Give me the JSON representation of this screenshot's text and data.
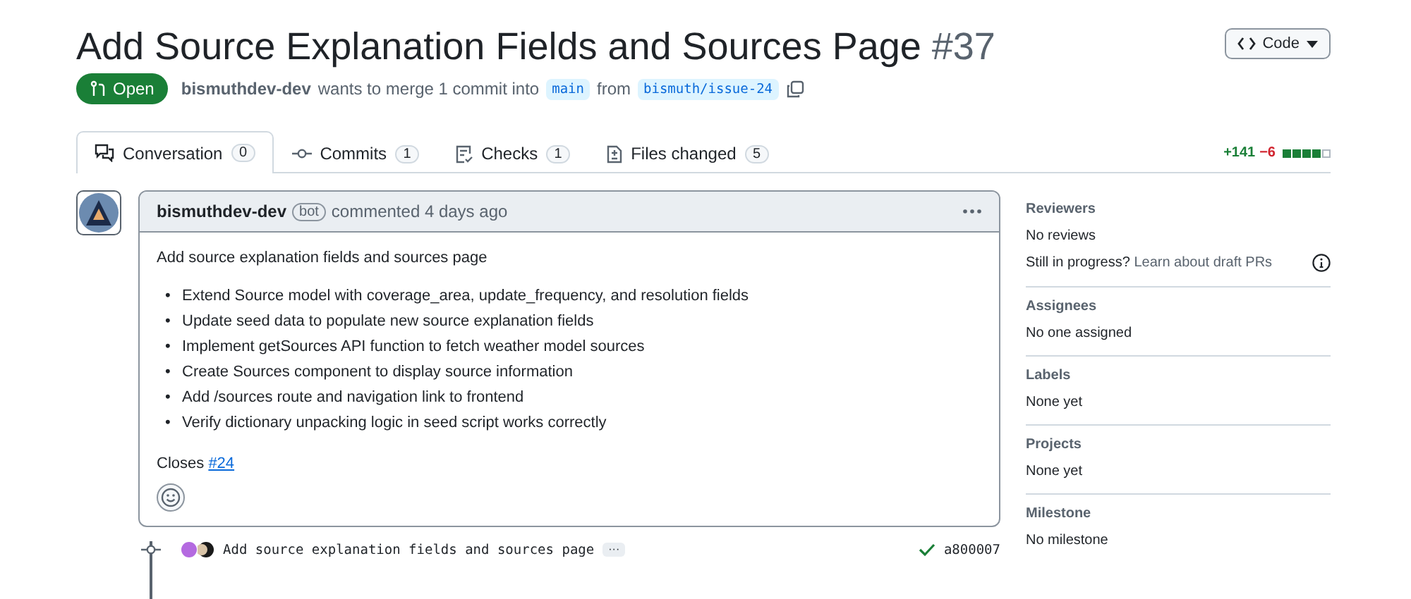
{
  "header": {
    "title": "Add Source Explanation Fields and Sources Page",
    "number": "#37",
    "code_button": "Code"
  },
  "meta": {
    "state": "Open",
    "author": "bismuthdev-dev",
    "text_1": "wants to merge 1 commit into",
    "base": "main",
    "text_2": "from",
    "head": "bismuth/issue-24"
  },
  "tabs": [
    {
      "label": "Conversation",
      "count": "0",
      "selected": true
    },
    {
      "label": "Commits",
      "count": "1",
      "selected": false
    },
    {
      "label": "Checks",
      "count": "1",
      "selected": false
    },
    {
      "label": "Files changed",
      "count": "5",
      "selected": false
    }
  ],
  "diffstat": {
    "added": "+141",
    "removed": "−6",
    "blocks": [
      {
        "kind": "added"
      },
      {
        "kind": "added"
      },
      {
        "kind": "added"
      },
      {
        "kind": "added"
      },
      {
        "kind": "neutral"
      }
    ]
  },
  "comment": {
    "author": "bismuthdev-dev",
    "badge": "bot",
    "time": "commented 4 days ago",
    "title": "Add source explanation fields and sources page",
    "bullets": [
      {
        "marker": "•",
        "text": "Extend Source model with coverage_area, update_frequency, and resolution fields"
      },
      {
        "marker": "•",
        "text": "Update seed data to populate new source explanation fields"
      },
      {
        "marker": "•",
        "text": "Implement getSources API function to fetch weather model sources"
      },
      {
        "marker": "•",
        "text": "Create Sources component to display source information"
      },
      {
        "marker": "•",
        "text": "Add /sources route and navigation link to frontend"
      },
      {
        "marker": "•",
        "text": "Verify dictionary unpacking logic in seed script works correctly"
      }
    ],
    "closes_text": "Closes",
    "closes_link": "#24"
  },
  "commit": {
    "message": "Add source explanation fields and sources page",
    "more": "···",
    "sha": "a800007"
  },
  "sidebar": [
    {
      "heading": "Reviewers",
      "value": "No reviews",
      "note": "Still in progress?",
      "note_link": "Learn about draft PRs"
    },
    {
      "heading": "Assignees",
      "value": "No one assigned"
    },
    {
      "heading": "Labels",
      "value": "None yet"
    },
    {
      "heading": "Projects",
      "value": "None yet"
    },
    {
      "heading": "Milestone",
      "value": "No milestone"
    }
  ]
}
